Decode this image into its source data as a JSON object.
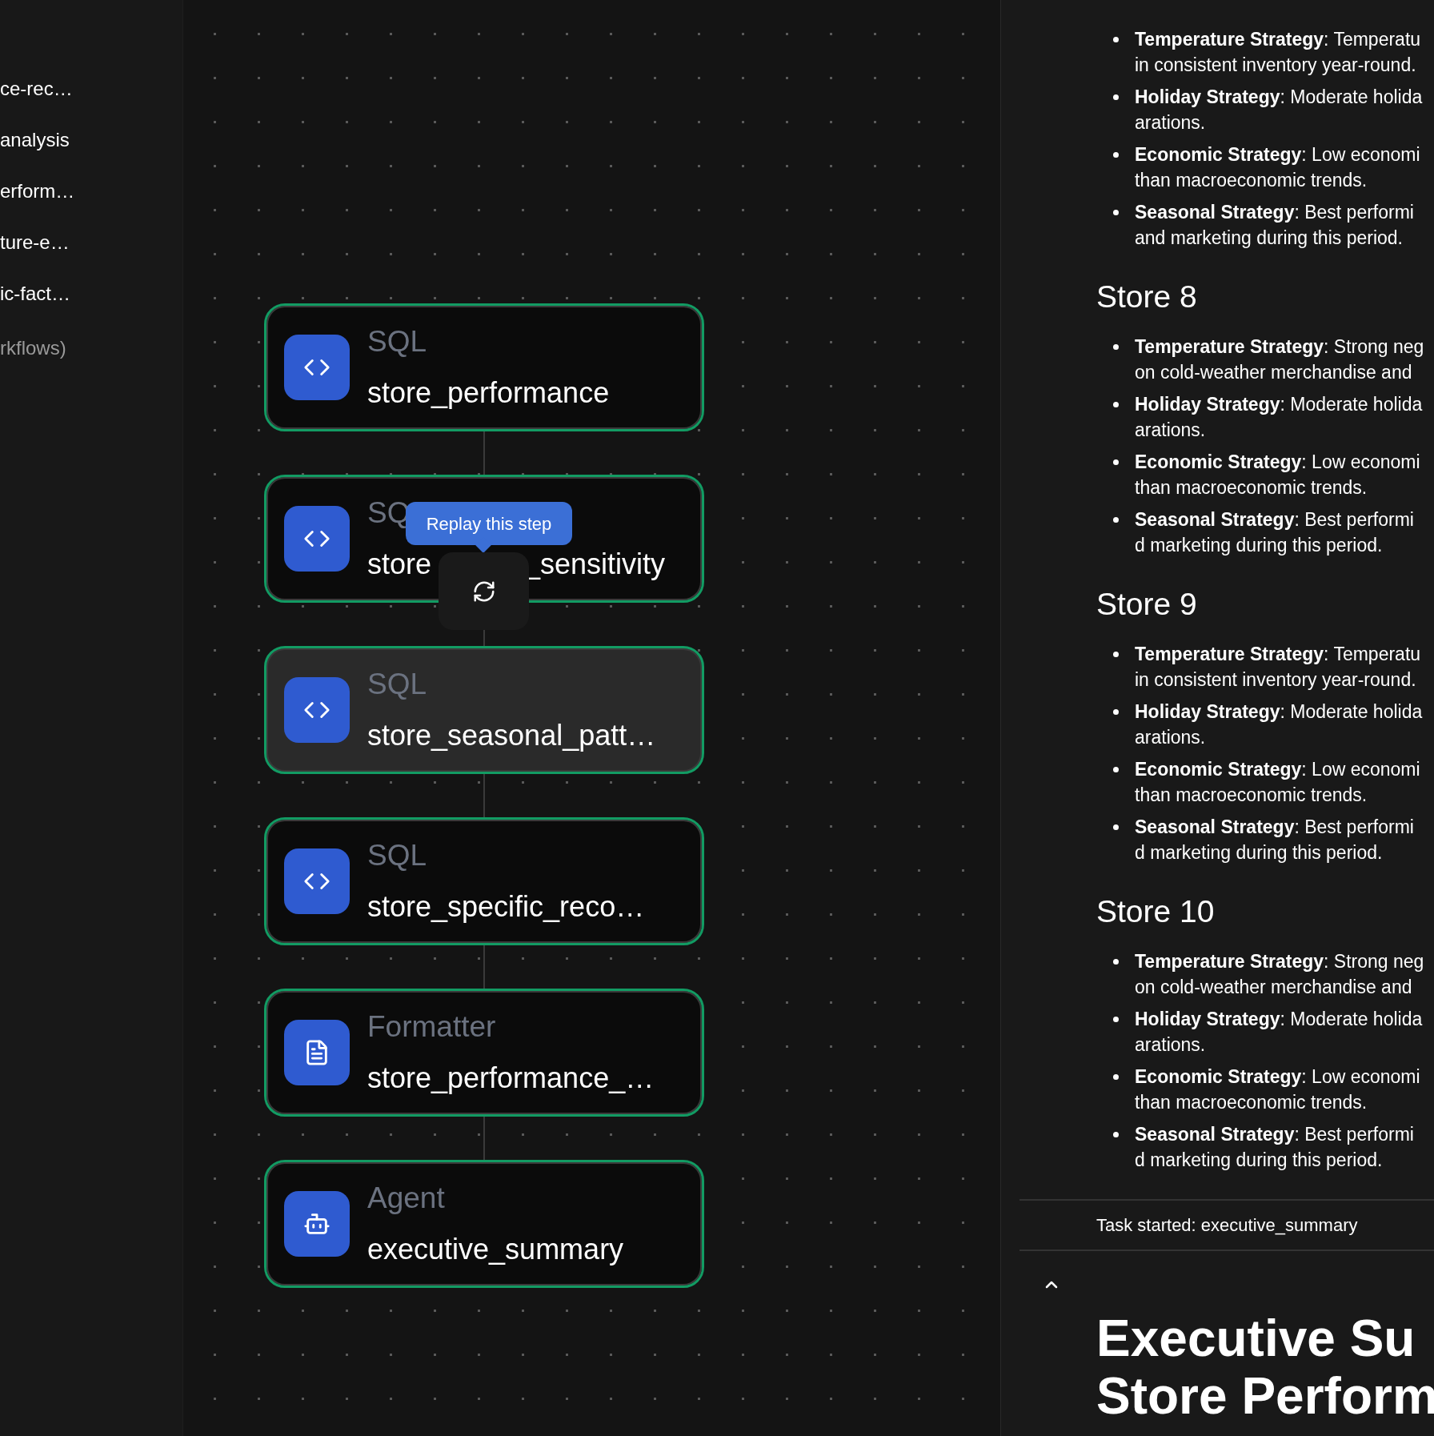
{
  "sidebar": {
    "items": [
      {
        "label": "ce-rec…",
        "muted": false
      },
      {
        "label": "analysis",
        "muted": false
      },
      {
        "label": "erform…",
        "muted": false
      },
      {
        "label": "ture-e…",
        "muted": false
      },
      {
        "label": "ic-fact…",
        "muted": false
      },
      {
        "label": "rkflows)",
        "muted": true
      }
    ]
  },
  "canvas": {
    "nodes": [
      {
        "kind": "sql",
        "type_label": "SQL",
        "name": "store_performance",
        "highlighted": false
      },
      {
        "kind": "sql",
        "type_label": "SQ",
        "name": "store",
        "name_after_cover": "_sensitivity",
        "highlighted": false
      },
      {
        "kind": "sql",
        "type_label": "SQL",
        "name": "store_seasonal_patt…",
        "highlighted": true
      },
      {
        "kind": "sql",
        "type_label": "SQL",
        "name": "store_specific_reco…",
        "highlighted": false
      },
      {
        "kind": "formatter",
        "type_label": "Formatter",
        "name": "store_performance_…",
        "highlighted": false
      },
      {
        "kind": "agent",
        "type_label": "Agent",
        "name": "executive_summary",
        "highlighted": false
      }
    ],
    "tooltip": "Replay this step"
  },
  "output": {
    "sections": [
      {
        "items": [
          {
            "lines": [
              "**Temperature Strategy**: Temperatu",
              "in consistent inventory year-round."
            ]
          },
          {
            "lines": [
              "**Holiday Strategy**: Moderate holida",
              "arations."
            ]
          },
          {
            "lines": [
              "**Economic Strategy**: Low economi",
              "than macroeconomic trends."
            ]
          },
          {
            "lines": [
              "**Seasonal Strategy**: Best performi",
              "and marketing during this period."
            ]
          }
        ]
      },
      {
        "heading": "Store 8",
        "items": [
          {
            "lines": [
              "**Temperature Strategy**: Strong neg",
              "on cold-weather merchandise and"
            ]
          },
          {
            "lines": [
              "**Holiday Strategy**: Moderate holida",
              "arations."
            ]
          },
          {
            "lines": [
              "**Economic Strategy**: Low economi",
              "than macroeconomic trends."
            ]
          },
          {
            "lines": [
              "**Seasonal Strategy**: Best performi",
              "d marketing during this period."
            ]
          }
        ]
      },
      {
        "heading": "Store 9",
        "items": [
          {
            "lines": [
              "**Temperature Strategy**: Temperatu",
              "in consistent inventory year-round."
            ]
          },
          {
            "lines": [
              "**Holiday Strategy**: Moderate holida",
              "arations."
            ]
          },
          {
            "lines": [
              "**Economic Strategy**: Low economi",
              "than macroeconomic trends."
            ]
          },
          {
            "lines": [
              "**Seasonal Strategy**: Best performi",
              "d marketing during this period."
            ]
          }
        ]
      },
      {
        "heading": "Store 10",
        "items": [
          {
            "lines": [
              "**Temperature Strategy**: Strong neg",
              "on cold-weather merchandise and"
            ]
          },
          {
            "lines": [
              "**Holiday Strategy**: Moderate holida",
              "arations."
            ]
          },
          {
            "lines": [
              "**Economic Strategy**: Low economi",
              "than macroeconomic trends."
            ]
          },
          {
            "lines": [
              "**Seasonal Strategy**: Best performi",
              "d marketing during this period."
            ]
          }
        ]
      }
    ],
    "task_status": "Task started: executive_summary",
    "summary_title_lines": [
      "Executive Su",
      "Store Perform"
    ]
  }
}
